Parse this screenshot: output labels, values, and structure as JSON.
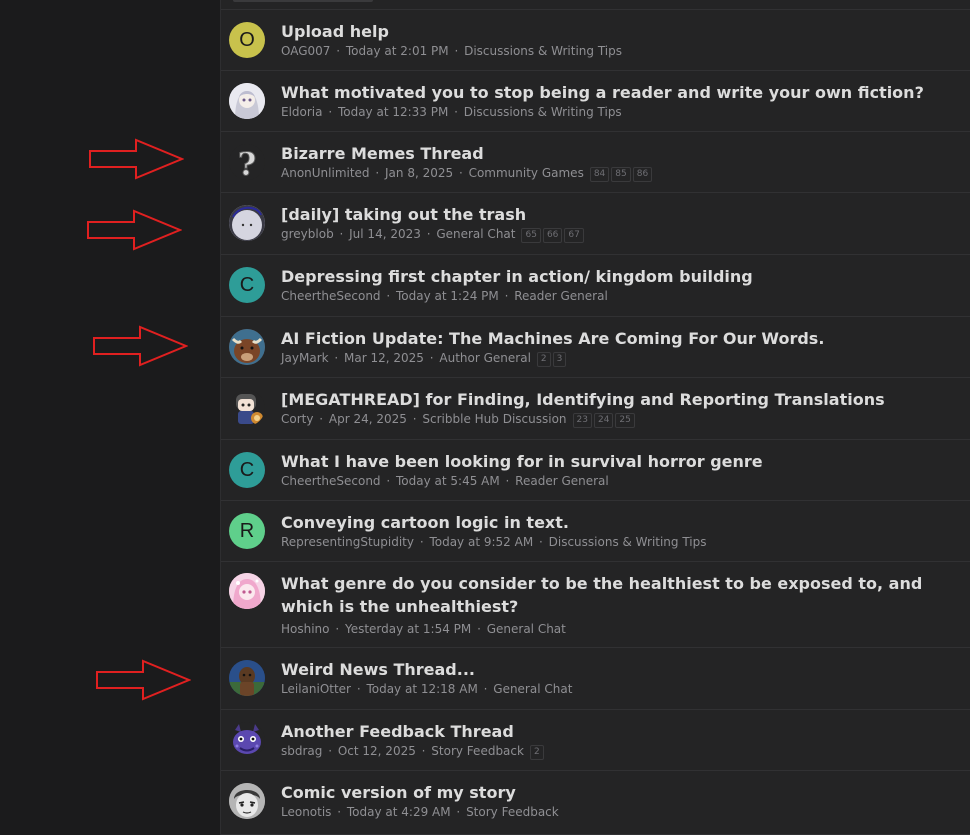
{
  "threads": [
    {
      "avatar_letter": "O",
      "avatar_color": "#c8c24c",
      "title": "Upload help",
      "author": "OAG007",
      "date": "Today at 2:01 PM",
      "forum": "Discussions & Writing Tips",
      "pages": []
    },
    {
      "avatar_letter": "",
      "avatar_color": "#d7d7e0",
      "avatar_icon": "anime-girl-avatar-icon",
      "title": "What motivated you to stop being a reader and write your own fiction?",
      "author": "Eldoria",
      "date": "Today at 12:33 PM",
      "forum": "Discussions & Writing Tips",
      "pages": []
    },
    {
      "avatar_letter": "",
      "avatar_color": "#242425",
      "avatar_icon": "question-mark-avatar-icon",
      "title": "Bizarre Memes Thread",
      "author": "AnonUnlimited",
      "date": "Jan 8, 2025",
      "forum": "Community Games",
      "pages": [
        "84",
        "85",
        "86"
      ]
    },
    {
      "avatar_letter": "",
      "avatar_color": "#c9c9d6",
      "avatar_icon": "grey-blob-avatar-icon",
      "title": "[daily] taking out the trash",
      "author": "greyblob",
      "date": "Jul 14, 2023",
      "forum": "General Chat",
      "pages": [
        "65",
        "66",
        "67"
      ]
    },
    {
      "avatar_letter": "C",
      "avatar_color": "#2e9d98",
      "title": "Depressing first chapter in action/ kingdom building",
      "author": "CheertheSecond",
      "date": "Today at 1:24 PM",
      "forum": "Reader General",
      "pages": []
    },
    {
      "avatar_letter": "",
      "avatar_color": "#6a3c25",
      "avatar_icon": "bull-avatar-icon",
      "title": "AI Fiction Update: The Machines Are Coming For Our Words.",
      "author": "JayMark",
      "date": "Mar 12, 2025",
      "forum": "Author General",
      "pages": [
        "2",
        "3"
      ]
    },
    {
      "avatar_letter": "",
      "avatar_color": "#242425",
      "avatar_icon": "chibi-character-avatar-icon",
      "title": "[MEGATHREAD] for Finding, Identifying and Reporting Translations",
      "author": "Corty",
      "date": "Apr 24, 2025",
      "forum": "Scribble Hub Discussion",
      "pages": [
        "23",
        "24",
        "25"
      ]
    },
    {
      "avatar_letter": "C",
      "avatar_color": "#2e9d98",
      "title": "What I have been looking for in survival horror genre",
      "author": "CheertheSecond",
      "date": "Today at 5:45 AM",
      "forum": "Reader General",
      "pages": []
    },
    {
      "avatar_letter": "R",
      "avatar_color": "#5fcf8b",
      "title": "Conveying cartoon logic in text.",
      "author": "RepresentingStupidity",
      "date": "Today at 9:52 AM",
      "forum": "Discussions & Writing Tips",
      "pages": []
    },
    {
      "avatar_letter": "",
      "avatar_color": "#f2c6dc",
      "avatar_icon": "pink-anime-avatar-icon",
      "title": "What genre do you consider to be the healthiest to be exposed to, and which is the unhealthiest?",
      "author": "Hoshino",
      "date": "Yesterday at 1:54 PM",
      "forum": "General Chat",
      "pages": []
    },
    {
      "avatar_letter": "",
      "avatar_color": "#1f3a66",
      "avatar_icon": "otter-character-avatar-icon",
      "title": "Weird News Thread...",
      "author": "LeilaniOtter",
      "date": "Today at 12:18 AM",
      "forum": "General Chat",
      "pages": []
    },
    {
      "avatar_letter": "",
      "avatar_color": "#242425",
      "avatar_icon": "purple-dragon-avatar-icon",
      "title": "Another Feedback Thread",
      "author": "sbdrag",
      "date": "Oct 12, 2025",
      "forum": "Story Feedback",
      "pages": [
        "2"
      ]
    },
    {
      "avatar_letter": "",
      "avatar_color": "#9a9a9a",
      "avatar_icon": "manga-face-avatar-icon",
      "title": "Comic version of my story",
      "author": "Leonotis",
      "date": "Today at 4:29 AM",
      "forum": "Story Feedback",
      "pages": []
    }
  ],
  "meta_separator": "·",
  "colors": {
    "annotation_arrow": "#e02020",
    "title_text": "#dcdcdc",
    "meta_text": "#8f8f93"
  },
  "annotation_arrow_icon": "right-arrow-outline-icon"
}
